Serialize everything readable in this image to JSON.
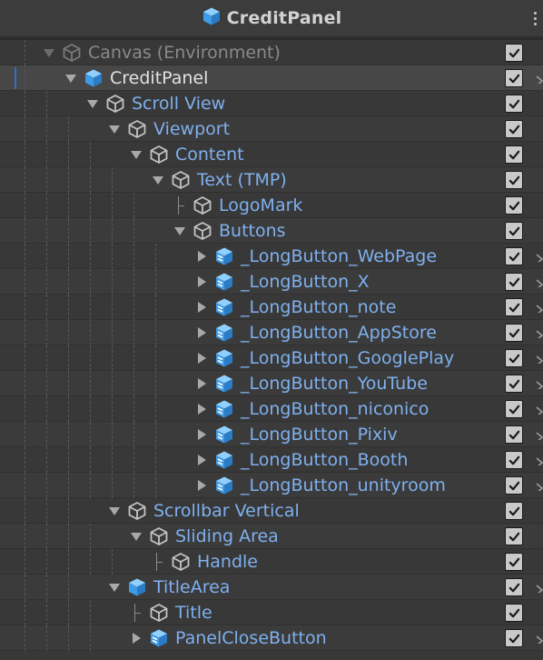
{
  "header": {
    "title": "CreditPanel",
    "icon": "prefab-cube-icon",
    "menu_icon": "kebab-menu-icon"
  },
  "colors": {
    "background": "#383838",
    "label": "#7fb0ee",
    "label_dim": "#8a8a8a",
    "label_selected": "#e2e2e2",
    "prefab_icon": "#53acef",
    "selection_bar": "#2f6fc8"
  },
  "hierarchy": [
    {
      "label": "Canvas (Environment)",
      "depth": 0,
      "toggle": "expanded",
      "icon": "gameobject-icon",
      "dim": true,
      "more": false
    },
    {
      "label": "CreditPanel",
      "depth": 1,
      "toggle": "expanded",
      "icon": "prefab-icon",
      "selected": true,
      "more": true
    },
    {
      "label": "Scroll View",
      "depth": 2,
      "toggle": "expanded",
      "icon": "gameobject-icon",
      "more": false
    },
    {
      "label": "Viewport",
      "depth": 3,
      "toggle": "expanded",
      "icon": "gameobject-icon",
      "more": false
    },
    {
      "label": "Content",
      "depth": 4,
      "toggle": "expanded",
      "icon": "gameobject-icon",
      "more": false
    },
    {
      "label": "Text (TMP)",
      "depth": 5,
      "toggle": "expanded",
      "icon": "gameobject-icon",
      "more": false
    },
    {
      "label": "LogoMark",
      "depth": 6,
      "toggle": "leaf",
      "icon": "gameobject-icon",
      "more": false
    },
    {
      "label": "Buttons",
      "depth": 6,
      "toggle": "expanded",
      "icon": "gameobject-icon",
      "more": false
    },
    {
      "label": "_LongButton_WebPage",
      "depth": 7,
      "toggle": "collapsed",
      "icon": "prefab-variant-icon",
      "more": true
    },
    {
      "label": "_LongButton_X",
      "depth": 7,
      "toggle": "collapsed",
      "icon": "prefab-variant-icon",
      "more": true
    },
    {
      "label": "_LongButton_note",
      "depth": 7,
      "toggle": "collapsed",
      "icon": "prefab-variant-icon",
      "more": true
    },
    {
      "label": "_LongButton_AppStore",
      "depth": 7,
      "toggle": "collapsed",
      "icon": "prefab-variant-icon",
      "more": true
    },
    {
      "label": "_LongButton_GooglePlay",
      "depth": 7,
      "toggle": "collapsed",
      "icon": "prefab-variant-icon",
      "more": true
    },
    {
      "label": "_LongButton_YouTube",
      "depth": 7,
      "toggle": "collapsed",
      "icon": "prefab-variant-icon",
      "more": true
    },
    {
      "label": "_LongButton_niconico",
      "depth": 7,
      "toggle": "collapsed",
      "icon": "prefab-variant-icon",
      "more": true
    },
    {
      "label": "_LongButton_Pixiv",
      "depth": 7,
      "toggle": "collapsed",
      "icon": "prefab-variant-icon",
      "more": true
    },
    {
      "label": "_LongButton_Booth",
      "depth": 7,
      "toggle": "collapsed",
      "icon": "prefab-variant-icon",
      "more": true
    },
    {
      "label": "_LongButton_unityroom",
      "depth": 7,
      "toggle": "collapsed",
      "icon": "prefab-variant-icon",
      "more": true
    },
    {
      "label": "Scrollbar Vertical",
      "depth": 3,
      "toggle": "expanded",
      "icon": "gameobject-icon",
      "more": false
    },
    {
      "label": "Sliding Area",
      "depth": 4,
      "toggle": "expanded",
      "icon": "gameobject-icon",
      "more": false
    },
    {
      "label": "Handle",
      "depth": 5,
      "toggle": "leaf",
      "icon": "gameobject-icon",
      "more": false
    },
    {
      "label": "TitleArea",
      "depth": 3,
      "toggle": "expanded",
      "icon": "prefab-icon",
      "more": true
    },
    {
      "label": "Title",
      "depth": 4,
      "toggle": "leaf",
      "icon": "gameobject-icon",
      "more": false
    },
    {
      "label": "PanelCloseButton",
      "depth": 4,
      "toggle": "collapsed",
      "icon": "prefab-variant-icon",
      "more": true
    }
  ]
}
